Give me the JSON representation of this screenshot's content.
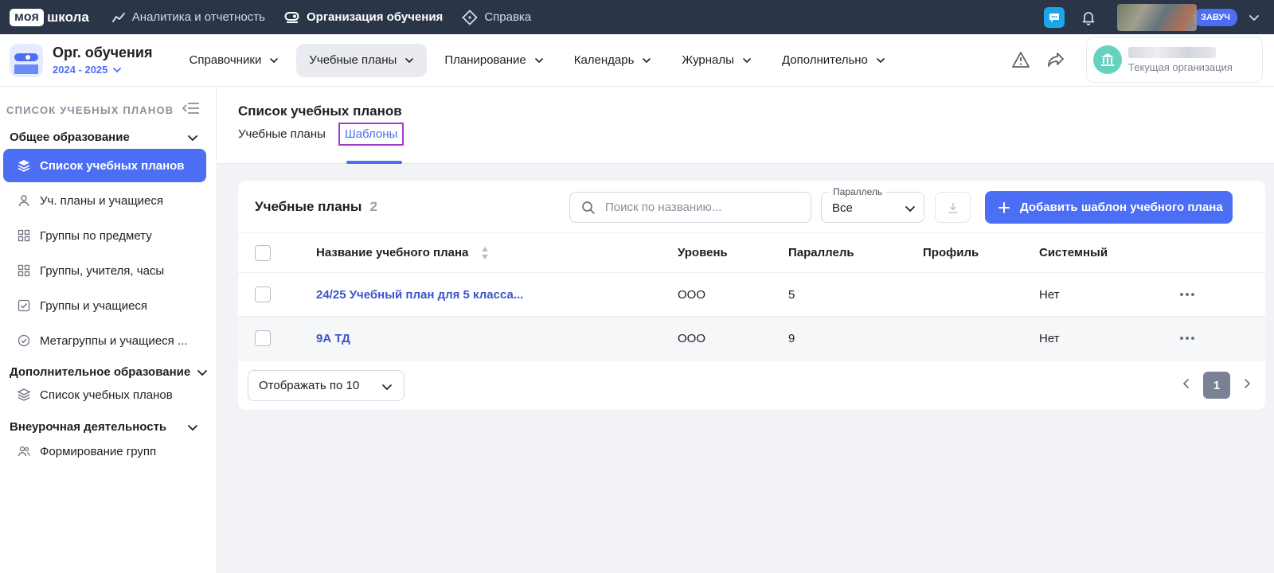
{
  "brand": {
    "part1": "моя",
    "part2": "школа"
  },
  "topnav": [
    {
      "label": "Аналитика и отчетность",
      "icon": "chart-line-icon"
    },
    {
      "label": "Организация обучения",
      "icon": "toggle-icon"
    },
    {
      "label": "Справка",
      "icon": "diamond-icon"
    }
  ],
  "user": {
    "role": "ЗАВУЧ"
  },
  "org": {
    "title": "Орг. обучения",
    "year": "2024 - 2025"
  },
  "menus": [
    {
      "label": "Справочники"
    },
    {
      "label": "Учебные планы"
    },
    {
      "label": "Планирование"
    },
    {
      "label": "Календарь"
    },
    {
      "label": "Журналы"
    },
    {
      "label": "Дополнительно"
    }
  ],
  "org_card": {
    "subtitle": "Текущая организация"
  },
  "sidebar": {
    "header": "СПИСОК УЧЕБНЫХ ПЛАНОВ",
    "sections": [
      {
        "title": "Общее образование"
      },
      {
        "title": "Дополнительное образование"
      },
      {
        "title": "Внеурочная деятельность"
      }
    ],
    "general_items": [
      {
        "label": "Список учебных планов"
      },
      {
        "label": "Уч. планы и учащиеся"
      },
      {
        "label": "Группы по предмету"
      },
      {
        "label": "Группы, учителя, часы"
      },
      {
        "label": "Группы и учащиеся"
      },
      {
        "label": "Метагруппы и учащиеся ..."
      }
    ],
    "additional_items": [
      {
        "label": "Список учебных планов"
      }
    ],
    "extracurricular_items": [
      {
        "label": "Формирование групп"
      }
    ]
  },
  "page": {
    "title": "Список учебных планов",
    "tabs": [
      {
        "label": "Учебные планы"
      },
      {
        "label": "Шаблоны"
      }
    ]
  },
  "card": {
    "title": "Учебные планы",
    "count": "2",
    "search_placeholder": "Поиск по названию...",
    "filter_label": "Параллель",
    "filter_value": "Все",
    "add_label": "Добавить шаблон учебного плана"
  },
  "table": {
    "headers": {
      "name": "Название учебного плана",
      "level": "Уровень",
      "parallel": "Параллель",
      "profile": "Профиль",
      "system": "Системный"
    },
    "rows": [
      {
        "name": "24/25 Учебный план для 5 класса...",
        "level": "ООО",
        "parallel": "5",
        "profile": "",
        "system": "Нет"
      },
      {
        "name": "9А ТД",
        "level": "ООО",
        "parallel": "9",
        "profile": "",
        "system": "Нет"
      }
    ]
  },
  "pagination": {
    "per_page": "Отображать по 10",
    "current": "1"
  },
  "colors": {
    "accent": "#4c6ef5",
    "topbar": "#2b3548",
    "tab_highlight": "#a23cc6"
  }
}
